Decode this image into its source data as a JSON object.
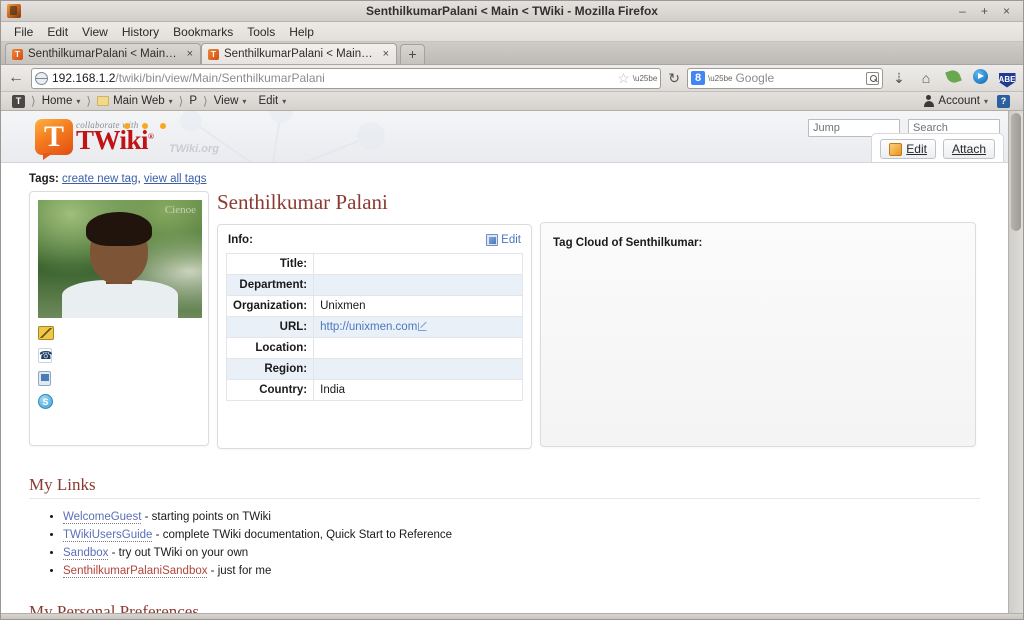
{
  "window": {
    "title": "SenthilkumarPalani < Main < TWiki - Mozilla Firefox",
    "minimize": "–",
    "maximize": "+",
    "close": "×"
  },
  "menubar": {
    "items": [
      "File",
      "Edit",
      "View",
      "History",
      "Bookmarks",
      "Tools",
      "Help"
    ]
  },
  "tabs": {
    "items": [
      {
        "label": "SenthilkumarPalani < Main <...",
        "close": "×",
        "active": false
      },
      {
        "label": "SenthilkumarPalani < Main <...",
        "close": "×",
        "active": true
      }
    ],
    "new_tab": "+"
  },
  "navbar": {
    "back": "←",
    "url_host": "192.168.1.2",
    "url_path": "/twiki/bin/view/Main/SenthilkumarPalani",
    "star": "☆",
    "reload": "↻",
    "search_engine": "8",
    "search_placeholder": "Google",
    "icons": [
      "download-icon",
      "home-icon",
      "leaf-icon",
      "media-play-icon",
      "abe-icon"
    ],
    "abe_label": "ABE"
  },
  "navstrip": {
    "crumbs": [
      {
        "label": "Home",
        "caret": "▾"
      },
      {
        "label": "Main Web",
        "caret": "▾"
      },
      {
        "label": "P",
        "caret": ""
      },
      {
        "label": "View",
        "caret": "▾"
      },
      {
        "label": "Edit",
        "caret": "▾"
      }
    ],
    "separator": "〉",
    "twiki_badge": "T",
    "account": "Account",
    "account_caret": "▾",
    "help": "?"
  },
  "twiki_header": {
    "logo_collaborate": "collaborate with",
    "logo_t": "T",
    "logo_word": "TWiki",
    "logo_reg": "®",
    "watermark": "TWiki.org",
    "jump_placeholder": "Jump",
    "search_placeholder": "Search",
    "edit_button": "Edit",
    "attach_button": "Attach"
  },
  "tags": {
    "label": "Tags:",
    "create_link": "create new tag",
    "separator": ",",
    "view_all_link": "view all tags"
  },
  "profile": {
    "page_title": "Senthilkumar Palani",
    "photo_watermark": "Cienoe",
    "photo_alt": "portrait-photo",
    "contacts": [
      {
        "name": "email-icon"
      },
      {
        "name": "phone-icon"
      },
      {
        "name": "mobile-icon"
      },
      {
        "name": "skype-icon"
      }
    ]
  },
  "info_box": {
    "heading": "Info:",
    "edit_label": "Edit",
    "rows": [
      {
        "key": "Title:",
        "value": ""
      },
      {
        "key": "Department:",
        "value": ""
      },
      {
        "key": "Organization:",
        "value": "Unixmen"
      },
      {
        "key": "URL:",
        "value": "http://unixmen.com",
        "is_link": true
      },
      {
        "key": "Location:",
        "value": ""
      },
      {
        "key": "Region:",
        "value": ""
      },
      {
        "key": "Country:",
        "value": "India"
      }
    ]
  },
  "tag_cloud": {
    "title": "Tag Cloud of Senthilkumar:"
  },
  "my_links": {
    "heading": "My Links",
    "items": [
      {
        "link": "WelcomeGuest",
        "color": "blue",
        "text": " - starting points on TWiki"
      },
      {
        "link": "TWikiUsersGuide",
        "color": "blue",
        "text": " - complete TWiki documentation, Quick Start to Reference"
      },
      {
        "link": "Sandbox",
        "color": "blue",
        "text": " - try out TWiki on your own"
      },
      {
        "link": "SenthilkumarPalaniSandbox",
        "color": "red",
        "text": " - just for me"
      }
    ]
  },
  "personal_prefs": {
    "heading": "My Personal Preferences"
  },
  "colors": {
    "twiki_red": "#c01313",
    "heading_maroon": "#8b3a32",
    "link_blue": "#5b6fb8",
    "link_red": "#b1443c",
    "table_alt_row": "#eaf0f8",
    "accent_orange": "#f47b20"
  }
}
